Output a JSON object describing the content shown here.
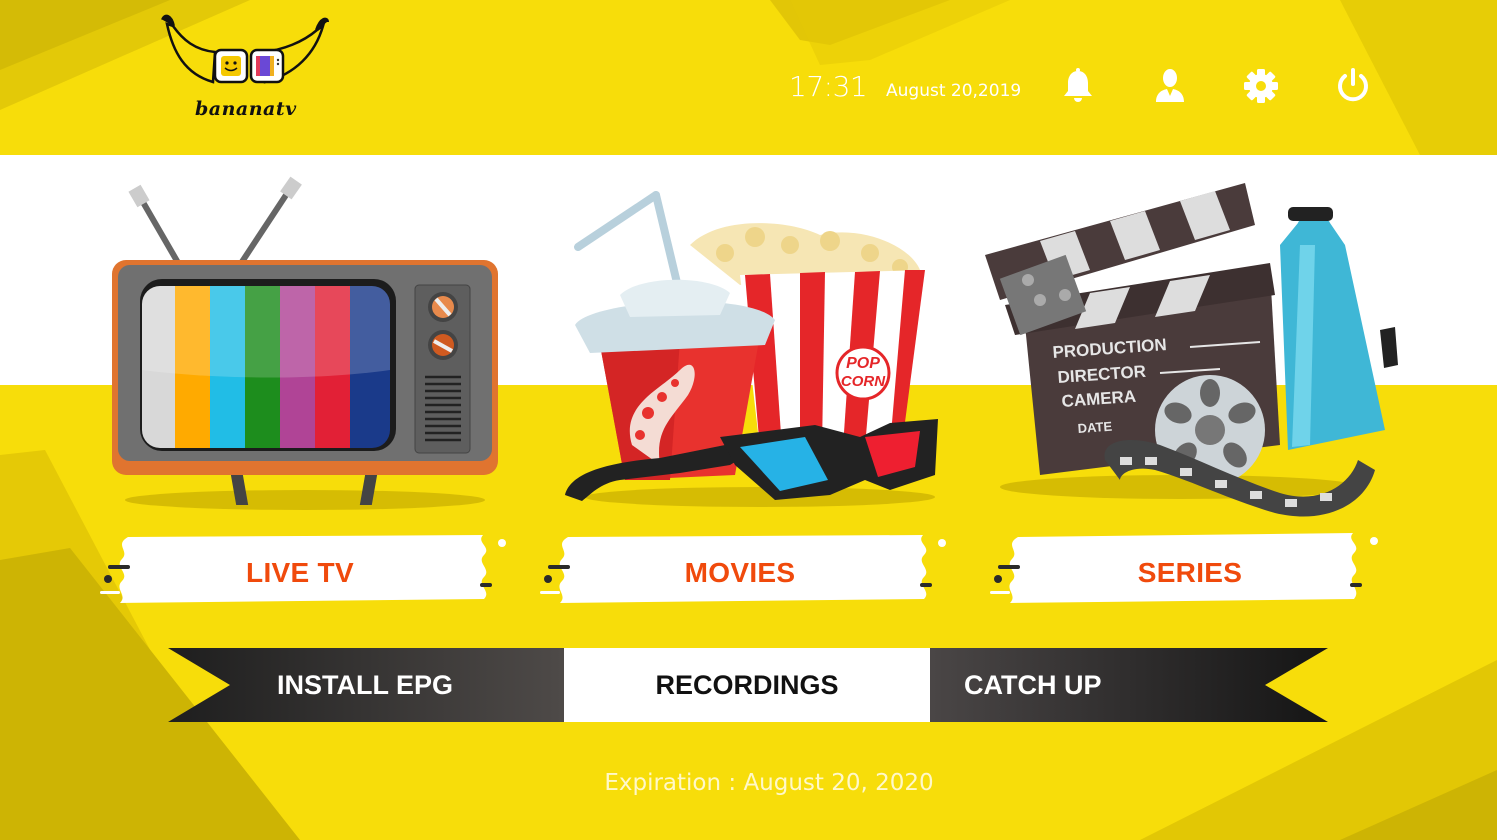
{
  "app": {
    "brand_name": "bananatv",
    "accent_color": "#f7dd0a",
    "label_color": "#f04a0c"
  },
  "header": {
    "time": "17:31",
    "date": "August 20,2019",
    "icons": [
      {
        "name": "bell-icon",
        "label": "Notifications"
      },
      {
        "name": "user-icon",
        "label": "Account"
      },
      {
        "name": "gear-icon",
        "label": "Settings"
      },
      {
        "name": "power-icon",
        "label": "Exit"
      }
    ]
  },
  "tiles": [
    {
      "id": "live-tv",
      "label": "LIVE TV",
      "art": "retro-tv-illustration"
    },
    {
      "id": "movies",
      "label": "MOVIES",
      "art": "popcorn-drink-3d-glasses-illustration"
    },
    {
      "id": "series",
      "label": "SERIES",
      "art": "clapperboard-film-reel-megaphone-illustration",
      "clapper_text": [
        "PRODUCTION",
        "DIRECTOR",
        "CAMERA",
        "DATE"
      ]
    }
  ],
  "ribbon": {
    "items": [
      {
        "label": "INSTALL EPG",
        "selected": false
      },
      {
        "label": "RECORDINGS",
        "selected": true
      },
      {
        "label": "CATCH UP",
        "selected": false
      }
    ]
  },
  "footer": {
    "expiration": "Expiration : August 20, 2020"
  }
}
